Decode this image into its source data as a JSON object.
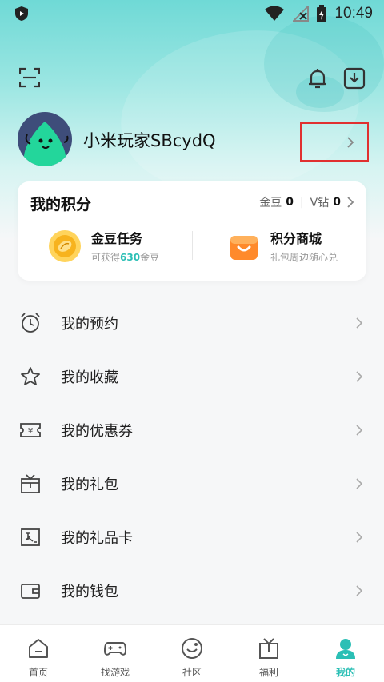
{
  "status_bar": {
    "time": "10:49",
    "icons": [
      "app-shield-icon",
      "wifi-icon",
      "no-signal-icon",
      "battery-charging-icon"
    ]
  },
  "header": {
    "icons": [
      "scan-icon",
      "bell-icon",
      "download-icon"
    ]
  },
  "profile": {
    "username": "小米玩家SBcydQ"
  },
  "points_card": {
    "title": "我的积分",
    "gold_label": "金豆",
    "gold_value": "0",
    "vdiamond_label": "V钻",
    "vdiamond_value": "0",
    "tasks": [
      {
        "title": "金豆任务",
        "sub_prefix": "可获得",
        "sub_highlight": "630",
        "sub_suffix": "金豆",
        "icon": "gold-coin-icon"
      },
      {
        "title": "积分商城",
        "sub": "礼包周边随心兑",
        "icon": "shopping-bag-icon"
      }
    ]
  },
  "menu": {
    "items": [
      {
        "label": "我的预约",
        "icon": "alarm-clock-icon"
      },
      {
        "label": "我的收藏",
        "icon": "star-icon"
      },
      {
        "label": "我的优惠券",
        "icon": "coupon-icon"
      },
      {
        "label": "我的礼包",
        "icon": "gift-box-icon"
      },
      {
        "label": "我的礼品卡",
        "icon": "gift-card-icon"
      },
      {
        "label": "我的钱包",
        "icon": "wallet-icon"
      }
    ]
  },
  "tabs": [
    {
      "label": "首页",
      "icon": "home-icon",
      "active": false
    },
    {
      "label": "找游戏",
      "icon": "gamepad-icon",
      "active": false
    },
    {
      "label": "社区",
      "icon": "community-icon",
      "active": false
    },
    {
      "label": "福利",
      "icon": "gift-icon",
      "active": false
    },
    {
      "label": "我的",
      "icon": "user-icon",
      "active": true
    }
  ],
  "colors": {
    "accent": "#2bbfb5",
    "header_gradient_top": "#6fd9d6",
    "highlight_border": "#e03030"
  }
}
